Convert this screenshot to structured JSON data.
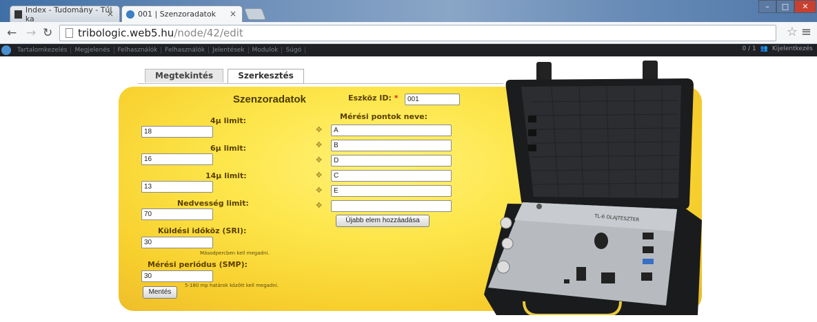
{
  "browser": {
    "tabs": [
      {
        "title": "Index - Tudomány - Tűl ka",
        "active": false
      },
      {
        "title": "001 | Szenzoradatok",
        "active": true
      }
    ],
    "url_host": "tribologic.web5.hu",
    "url_path": "/node/42/edit"
  },
  "adminbar": {
    "items": [
      "Tartalomkezelés",
      "Megjelenés",
      "Felhasználók",
      "Felhasználók",
      "Jelentések",
      "Modulok",
      "Súgó"
    ],
    "right_text": "0 / 1",
    "logout": "Kijelentkezés"
  },
  "page_tabs": [
    "Megtekintés",
    "Szerkesztés"
  ],
  "form": {
    "title": "Szenzoradatok",
    "device_id_label": "Eszköz ID:",
    "required_mark": "*",
    "device_id_value": "001",
    "measure_points_label": "Mérési pontok neve:",
    "limits": [
      {
        "label": "4µ limit:",
        "value": "18"
      },
      {
        "label": "6µ limit:",
        "value": "16"
      },
      {
        "label": "14µ limit:",
        "value": "13"
      },
      {
        "label": "Nedvesség limit:",
        "value": "70"
      }
    ],
    "sri": {
      "label": "Küldési időköz (SRI):",
      "value": "30",
      "desc": "Másodpercben kell megadni."
    },
    "smp": {
      "label": "Mérési periódus (SMP):",
      "value": "30",
      "desc": "5-180 mp határok között kell megadni."
    },
    "points": [
      "A",
      "B",
      "D",
      "C",
      "E",
      ""
    ],
    "add_button": "Újabb elem hozzáadása",
    "save_button": "Mentés"
  },
  "colors": {
    "panel": "#f7cf2d",
    "label": "#5a3e00",
    "required": "#d9202a",
    "case": "#1e1f21"
  }
}
